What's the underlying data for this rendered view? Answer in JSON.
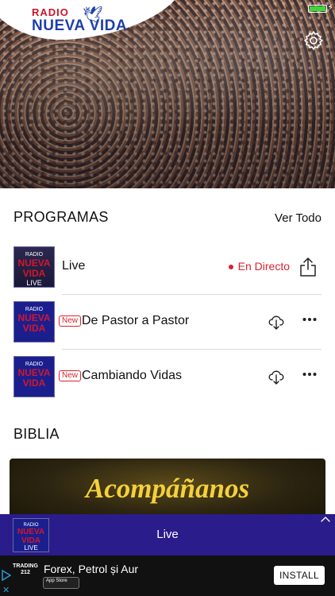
{
  "header": {
    "logo_top": "RADIO",
    "logo_bottom": "NUEVA VIDA",
    "battery_color": "#3ad83a"
  },
  "programs": {
    "title": "PROGRAMAS",
    "see_all": "Ver Todo",
    "items": [
      {
        "title": "Live",
        "status": "En Directo",
        "thumb_top": "RADIO",
        "thumb_main": "NUEVA VIDA",
        "thumb_bottom": "LIVE",
        "icon": "share-icon"
      },
      {
        "title": "De Pastor a Pastor",
        "badge": "New",
        "thumb_top": "RADIO",
        "thumb_main": "NUEVA VIDA",
        "icon": "download-icon"
      },
      {
        "title": "Cambiando Vidas",
        "badge": "New",
        "thumb_top": "RADIO",
        "thumb_main": "NUEVA VIDA",
        "icon": "download-icon"
      }
    ]
  },
  "bible": {
    "title": "BIBLIA",
    "banner_text": "Acompáñanos"
  },
  "player": {
    "label": "Live",
    "thumb_top": "RADIO",
    "thumb_main": "NUEVA VIDA",
    "thumb_bottom": "LIVE",
    "background": "#2a1c8a"
  },
  "ad": {
    "brand": "TRADING 212",
    "store_badge": "App Store",
    "text": "Forex, Petrol și Aur",
    "install_label": "INSTALL"
  },
  "colors": {
    "accent_red": "#d9232f",
    "brand_blue": "#1f3fa8"
  }
}
